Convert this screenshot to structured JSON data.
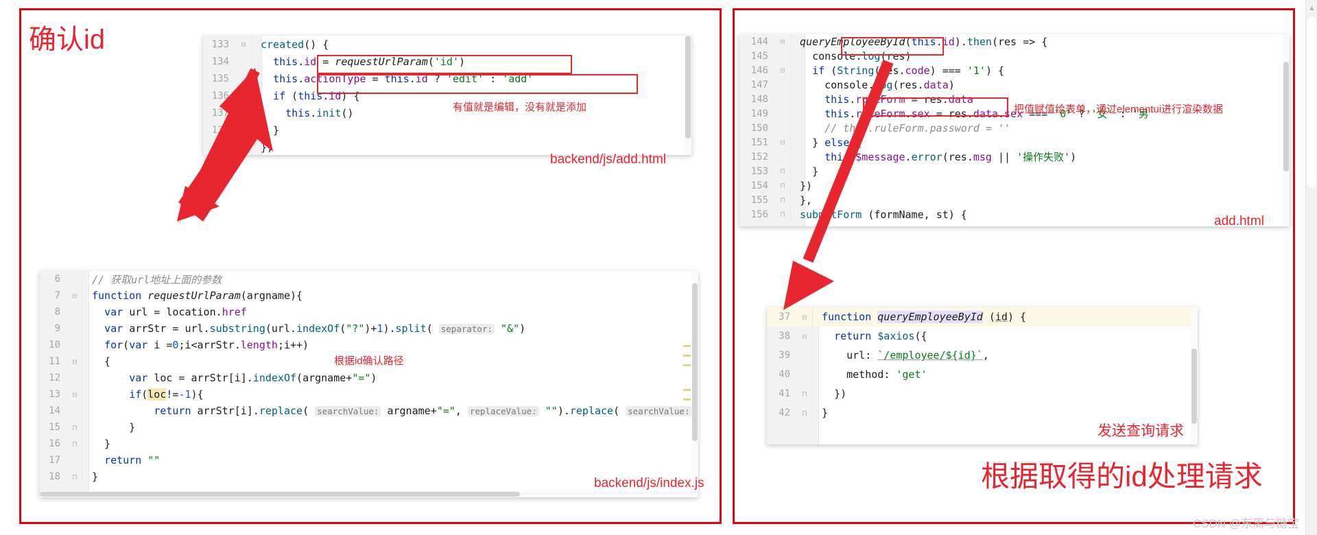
{
  "page": {
    "watermark": "CSDN @东离与糖宝"
  },
  "left_panel": {
    "title": "确认id",
    "card_add_html": {
      "file_tag": "backend/js/add.html",
      "note_inline": "有值就是编辑，没有就是添加",
      "lines": [
        {
          "no": "133",
          "fold": "minus",
          "text": "created() {"
        },
        {
          "no": "134",
          "fold": "",
          "text": "  this.id = requestUrlParam('id')"
        },
        {
          "no": "135",
          "fold": "",
          "text": "  this.actionType = this.id ? 'edit' : 'add'"
        },
        {
          "no": "136",
          "fold": "minus",
          "text": "  if (this.id) {"
        },
        {
          "no": "137",
          "fold": "",
          "text": "    this.init()"
        },
        {
          "no": "138",
          "fold": "up",
          "text": "  }"
        },
        {
          "no": "139",
          "fold": "up",
          "text": "},"
        }
      ]
    },
    "card_index_js": {
      "file_tag": "backend/js/index.js",
      "note_inline": "根据id确认路径",
      "lines": [
        {
          "no": "6",
          "fold": "",
          "text": "// 获取url地址上面的参数"
        },
        {
          "no": "7",
          "fold": "minus",
          "text": "function requestUrlParam(argname){"
        },
        {
          "no": "8",
          "fold": "",
          "text": "  var url = location.href"
        },
        {
          "no": "9",
          "fold": "",
          "text": "  var arrStr = url.substring(url.indexOf(\"?\")+1).split( separator: \"&\")"
        },
        {
          "no": "10",
          "fold": "",
          "text": "  for(var i =0;i<arrStr.length;i++)"
        },
        {
          "no": "11",
          "fold": "minus",
          "text": "  {"
        },
        {
          "no": "12",
          "fold": "",
          "text": "      var loc = arrStr[i].indexOf(argname+\"=\")"
        },
        {
          "no": "13",
          "fold": "minus",
          "text": "      if(loc!=-1){"
        },
        {
          "no": "14",
          "fold": "",
          "text": "          return arrStr[i].replace( searchValue: argname+\"=\", replaceValue: \"\").replace( searchValue: \"?\", replaceVal"
        },
        {
          "no": "15",
          "fold": "up",
          "text": "      }"
        },
        {
          "no": "16",
          "fold": "up",
          "text": "  }"
        },
        {
          "no": "17",
          "fold": "",
          "text": "  return \"\""
        },
        {
          "no": "18",
          "fold": "up",
          "text": "}"
        }
      ]
    }
  },
  "right_panel": {
    "card_add_html": {
      "file_tag": "add.html",
      "note_inline": "把值赋值给表单，通过elementui进行渲染数据",
      "lines": [
        {
          "no": "144",
          "fold": "minus",
          "text": "queryEmployeeById(this.id).then(res => {"
        },
        {
          "no": "145",
          "fold": "",
          "text": "  console.log(res)"
        },
        {
          "no": "146",
          "fold": "minus",
          "text": "  if (String(res.code) === '1') {"
        },
        {
          "no": "147",
          "fold": "",
          "text": "    console.log(res.data)"
        },
        {
          "no": "148",
          "fold": "",
          "text": "    this.ruleForm = res.data"
        },
        {
          "no": "149",
          "fold": "",
          "text": "    this.ruleForm.sex = res.data.sex === '0' ? '女' : '男'"
        },
        {
          "no": "150",
          "fold": "",
          "text": "    // this.ruleForm.password = ''"
        },
        {
          "no": "151",
          "fold": "minus",
          "text": "  } else {"
        },
        {
          "no": "152",
          "fold": "",
          "text": "    this.$message.error(res.msg || '操作失败')"
        },
        {
          "no": "153",
          "fold": "up",
          "text": "  }"
        },
        {
          "no": "154",
          "fold": "up",
          "text": "})"
        },
        {
          "no": "155",
          "fold": "up",
          "text": "},"
        },
        {
          "no": "156",
          "fold": "up",
          "text": "submitForm (formName, st) {"
        }
      ]
    },
    "card_request_js": {
      "note_inline": "发送查询请求",
      "lines": [
        {
          "no": "37",
          "fold": "minus",
          "text": "function queryEmployeeById (id) {"
        },
        {
          "no": "38",
          "fold": "minus",
          "text": "  return $axios({"
        },
        {
          "no": "39",
          "fold": "",
          "text": "    url: `/employee/${id}`,"
        },
        {
          "no": "40",
          "fold": "",
          "text": "    method: 'get'"
        },
        {
          "no": "41",
          "fold": "up",
          "text": "  })"
        },
        {
          "no": "42",
          "fold": "up",
          "text": "}"
        }
      ]
    },
    "title": "根据取得的id处理请求"
  },
  "colors": {
    "accent_red": "#e8262f",
    "border_red": "#e60012",
    "keyword_blue": "#0033b3",
    "string_green": "#067d17",
    "property_purple": "#871094",
    "function_teal": "#00627a",
    "comment_gray": "#8c8c8c"
  }
}
